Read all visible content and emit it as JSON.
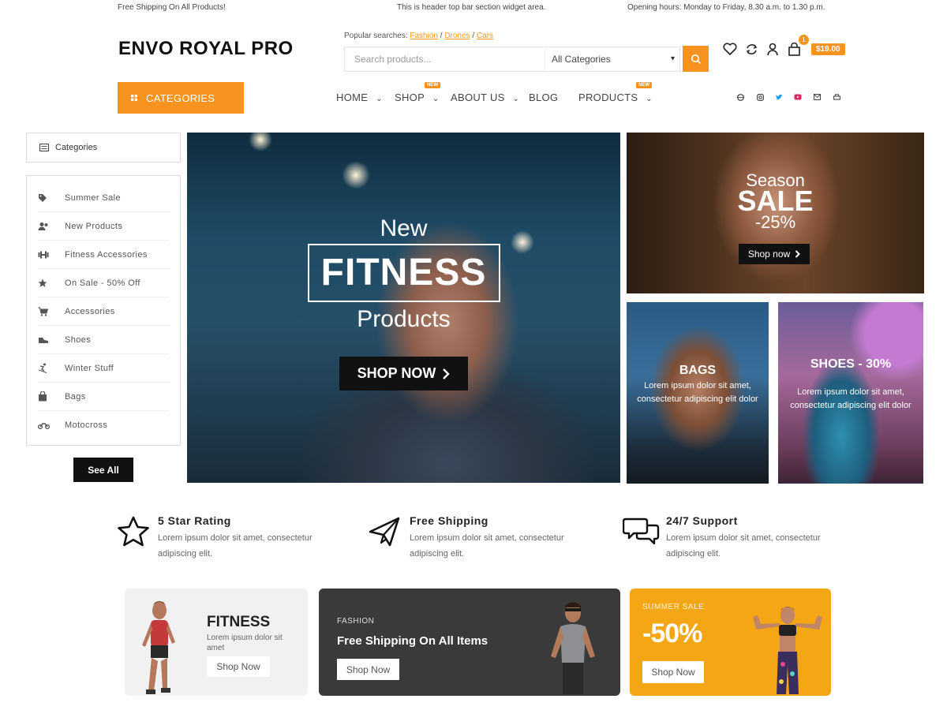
{
  "topbar": {
    "left": "Free Shipping On All Products!",
    "center": "This is header top bar section widget area.",
    "right": "Opening hours: Monday to Friday, 8.30 a.m. to 1.30 p.m."
  },
  "header": {
    "logo": "ENVO ROYAL PRO",
    "popular_label": "Popular searches:",
    "popular_links": [
      "Fashion",
      "Drones",
      "Cars"
    ],
    "search_placeholder": "Search products...",
    "category_select": "All Categories",
    "cart_count": "1",
    "cart_total": "$19.00"
  },
  "nav": {
    "categories_button": "CATEGORIES",
    "items": [
      {
        "label": "HOME",
        "has_dropdown": true,
        "badge": ""
      },
      {
        "label": "SHOP",
        "has_dropdown": true,
        "badge": "NEW"
      },
      {
        "label": "ABOUT US",
        "has_dropdown": true,
        "badge": ""
      },
      {
        "label": "BLOG",
        "has_dropdown": false,
        "badge": ""
      },
      {
        "label": "PRODUCTS",
        "has_dropdown": true,
        "badge": "NEW"
      }
    ],
    "social_icons": [
      "globe-icon",
      "instagram-icon",
      "twitter-icon",
      "youtube-icon",
      "email-icon",
      "print-icon"
    ]
  },
  "sidebar": {
    "header": "Categories",
    "items": [
      {
        "label": "Summer Sale",
        "icon": "tag-icon"
      },
      {
        "label": "New Products",
        "icon": "users-icon"
      },
      {
        "label": "Fitness Accessories",
        "icon": "dumbbell-icon"
      },
      {
        "label": "On Sale - 50% Off",
        "icon": "star-icon"
      },
      {
        "label": "Accessories",
        "icon": "cart-icon"
      },
      {
        "label": "Shoes",
        "icon": "shoe-icon"
      },
      {
        "label": "Winter Stuff",
        "icon": "skier-icon"
      },
      {
        "label": "Bags",
        "icon": "bag-icon"
      },
      {
        "label": "Motocross",
        "icon": "motorcycle-icon"
      }
    ],
    "see_all": "See All"
  },
  "hero": {
    "line1": "New",
    "line2": "FITNESS",
    "line3": "Products",
    "button": "SHOP NOW"
  },
  "promo_sale": {
    "line1": "Season",
    "line2": "SALE",
    "line3": "-25%",
    "button": "Shop now"
  },
  "promo_bags": {
    "title": "BAGS",
    "desc": "Lorem ipsum dolor sit amet, consectetur adipiscing elit dolor"
  },
  "promo_shoes": {
    "title": "SHOES - 30%",
    "desc": "Lorem ipsum dolor sit amet, consectetur adipiscing elit dolor"
  },
  "features": [
    {
      "title": "5 Star Rating",
      "desc": "Lorem ipsum dolor sit amet, consectetur adipiscing elit.",
      "icon": "star-outline-icon"
    },
    {
      "title": "Free Shipping",
      "desc": "Lorem ipsum dolor sit amet, consectetur adipiscing elit.",
      "icon": "paper-plane-icon"
    },
    {
      "title": "24/7 Support",
      "desc": "Lorem ipsum dolor sit amet, consectetur adipiscing elit.",
      "icon": "chat-icon"
    }
  ],
  "cards": [
    {
      "kicker": "",
      "title": "FITNESS",
      "desc": "Lorem ipsum dolor sit amet",
      "button": "Shop Now"
    },
    {
      "kicker": "FASHION",
      "title": "Free Shipping On All Items",
      "desc": "",
      "button": "Shop Now"
    },
    {
      "kicker": "SUMMER SALE",
      "title": "-50%",
      "desc": "",
      "button": "Shop Now"
    }
  ],
  "colors": {
    "accent": "#f7931e",
    "dark": "#111111",
    "card_dark": "#3a3a3a",
    "card_orange": "#f5a614"
  }
}
